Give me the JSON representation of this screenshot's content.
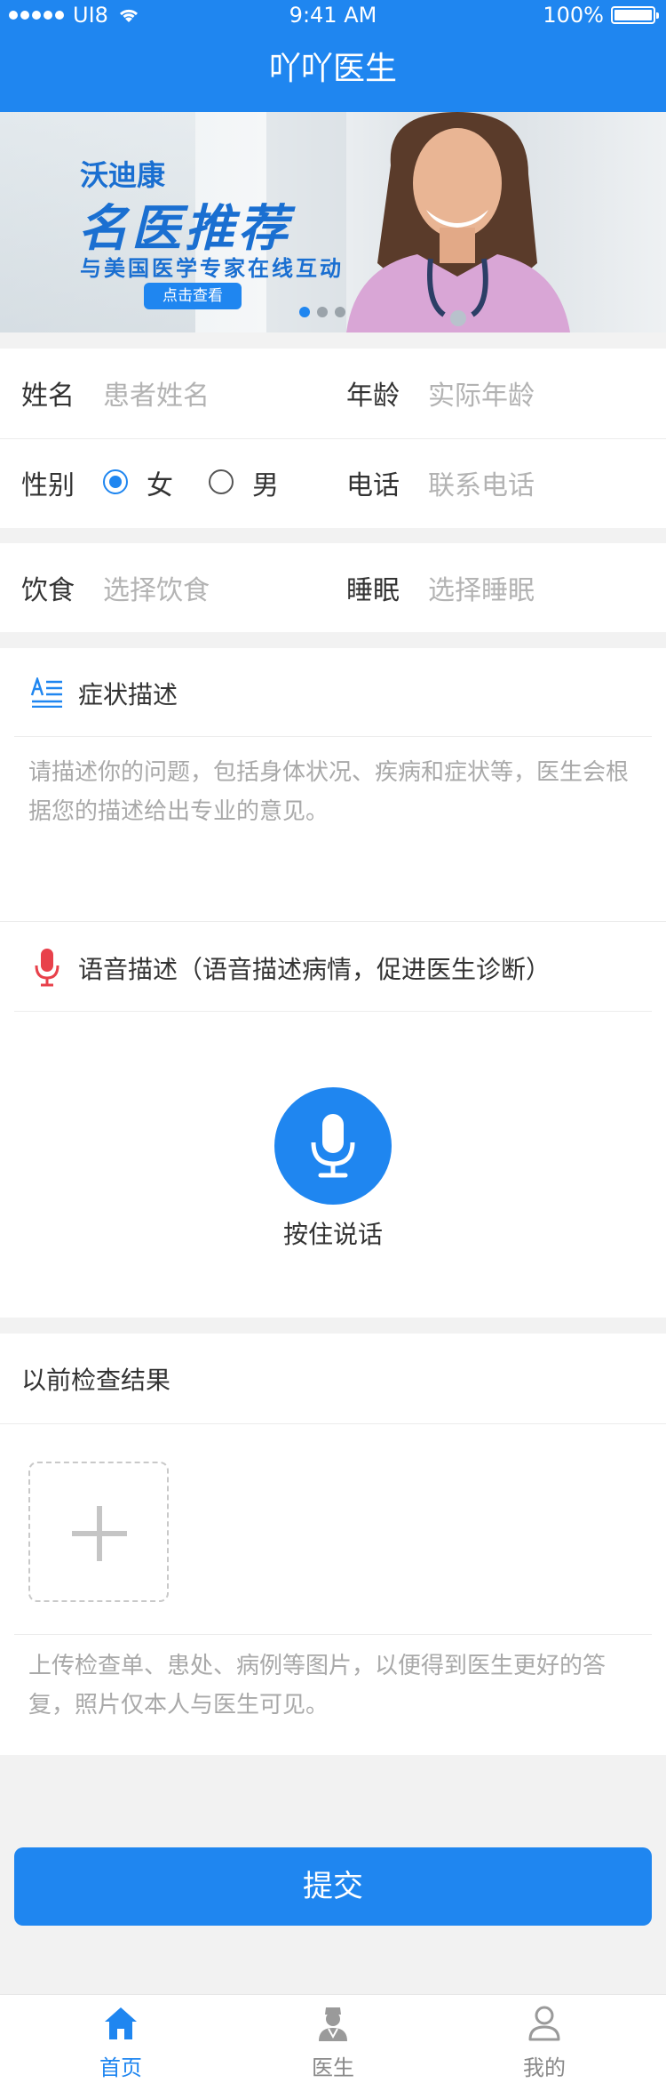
{
  "status_bar": {
    "carrier": "UI8",
    "time": "9:41 AM",
    "battery": "100%"
  },
  "nav": {
    "title": "吖吖医生"
  },
  "banner": {
    "line1": "沃迪康",
    "line2": "名医推荐",
    "line3": "与美国医学专家在线互动",
    "button": "点击查看",
    "pages": 3,
    "active_page": 1
  },
  "form": {
    "name": {
      "label": "姓名",
      "placeholder": "患者姓名"
    },
    "age": {
      "label": "年龄",
      "placeholder": "实际年龄"
    },
    "gender": {
      "label": "性别",
      "options": [
        "女",
        "男"
      ],
      "selected": "女"
    },
    "phone": {
      "label": "电话",
      "placeholder": "联系电话"
    },
    "diet": {
      "label": "饮食",
      "placeholder": "选择饮食"
    },
    "sleep": {
      "label": "睡眠",
      "placeholder": "选择睡眠"
    }
  },
  "symptom": {
    "title": "症状描述",
    "placeholder": "请描述你的问题，包括身体状况、疾病和症状等，医生会根据您的描述给出专业的意见。"
  },
  "voice": {
    "title": "语音描述（语音描述病情，促进医生诊断）",
    "hold_label": "按住说话"
  },
  "results": {
    "title": "以前检查结果",
    "hint": "上传检查单、患处、病例等图片，以便得到医生更好的答复，照片仅本人与医生可见。"
  },
  "submit_label": "提交",
  "tabs": [
    {
      "label": "首页",
      "icon": "home-icon",
      "active": true
    },
    {
      "label": "医生",
      "icon": "doctor-icon",
      "active": false
    },
    {
      "label": "我的",
      "icon": "user-icon",
      "active": false
    }
  ],
  "colors": {
    "primary": "#1f86f0",
    "mic_red": "#e8414b",
    "placeholder": "#b3b3b3"
  }
}
